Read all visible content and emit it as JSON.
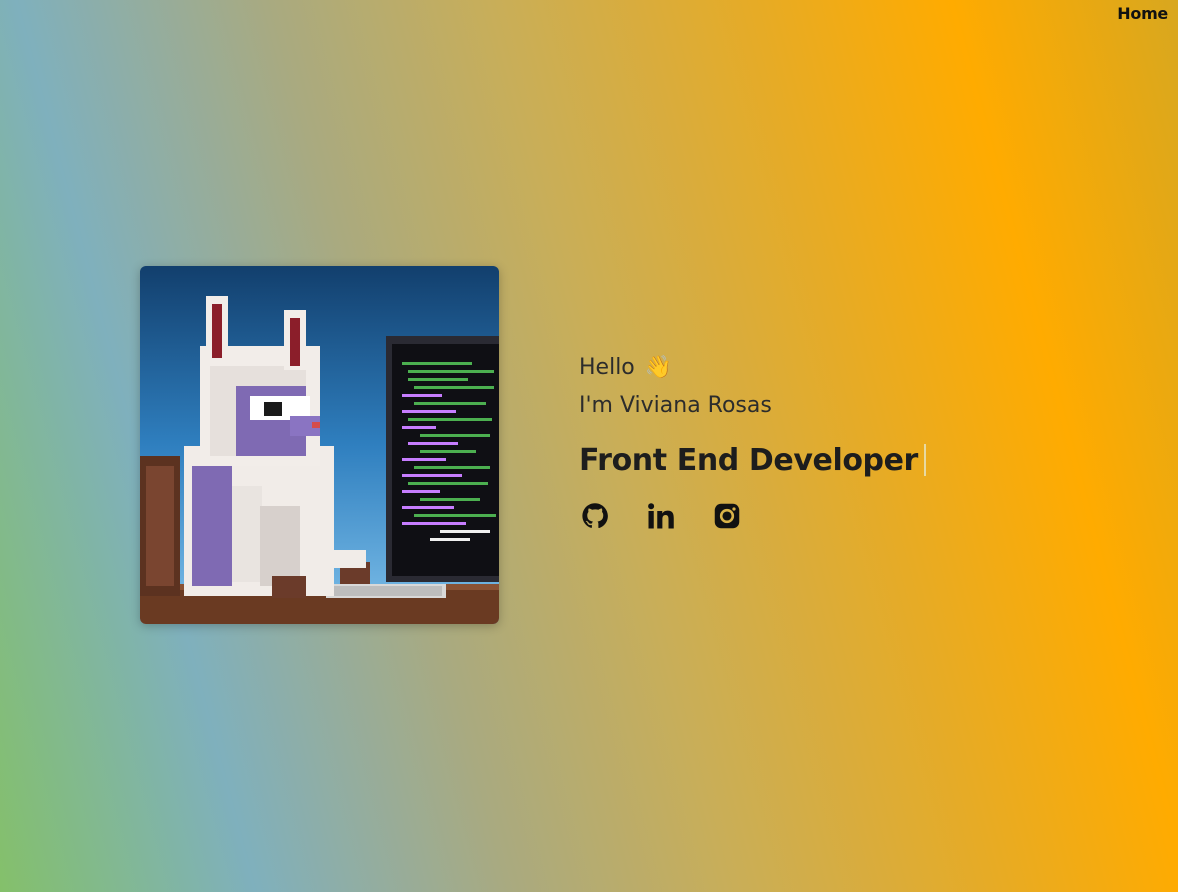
{
  "nav": {
    "home_label": "Home"
  },
  "hero": {
    "illustration": "pixel-art llama coding at a computer monitor"
  },
  "intro": {
    "greeting": "Hello",
    "greeting_emoji": "👋",
    "name_line": "I'm Viviana Rosas",
    "role": "Front End Developer"
  },
  "socials": [
    {
      "icon": "github-icon"
    },
    {
      "icon": "linkedin-icon"
    },
    {
      "icon": "instagram-icon"
    }
  ],
  "colors": {
    "text": "#2c2c2c",
    "heading": "#1d1d1d",
    "bg_left": "#84c06a",
    "bg_right": "#ffab00"
  }
}
